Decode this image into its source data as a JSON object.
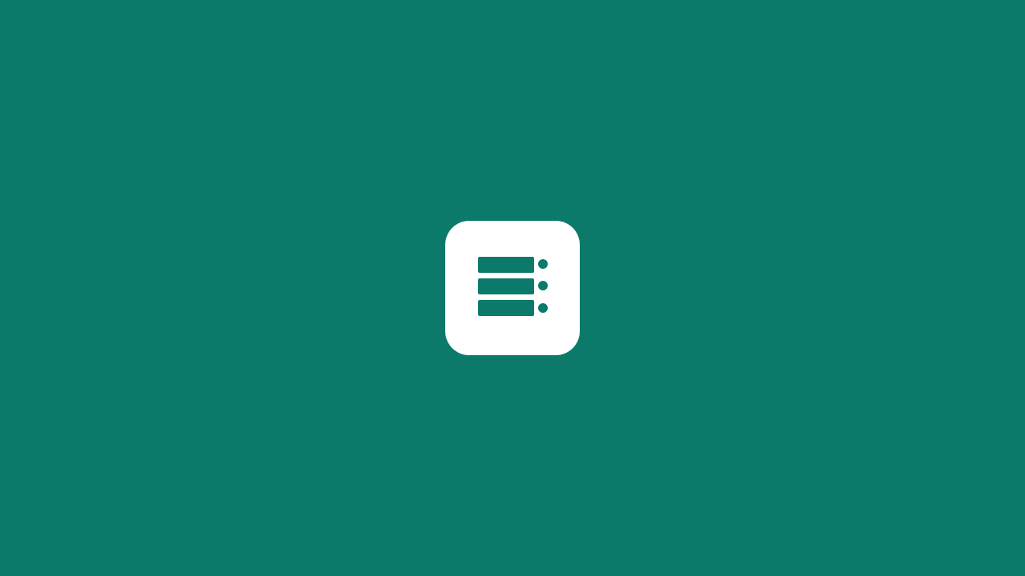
{
  "screen": {
    "type": "splash",
    "background_color": "#0b7a6a"
  },
  "app_icon": {
    "icon": "server-list-icon",
    "tile_color": "#ffffff",
    "glyph_color": "#0b7a6a"
  }
}
